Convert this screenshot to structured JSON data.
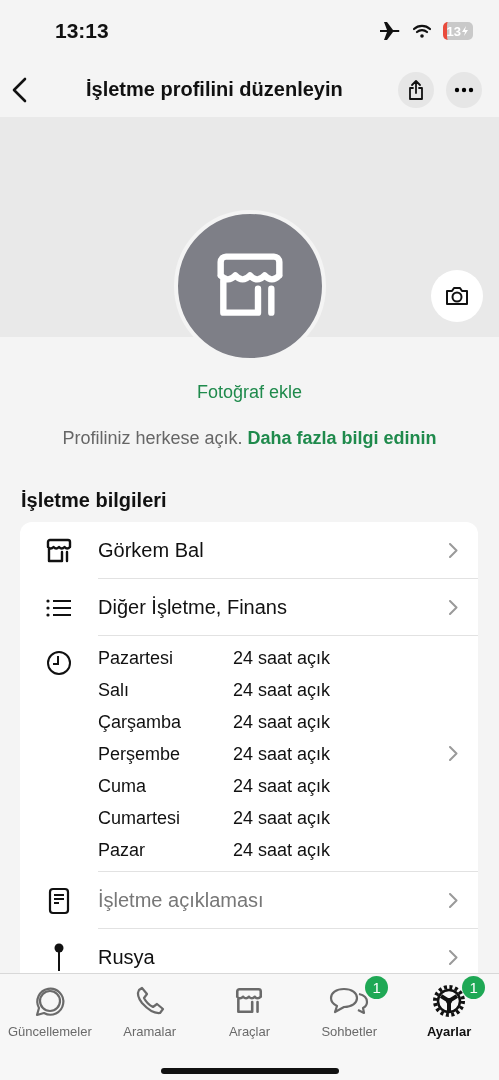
{
  "status_bar": {
    "time": "13:13",
    "battery": "13"
  },
  "nav": {
    "title": "İşletme profilini düzenleyin"
  },
  "profile": {
    "add_photo": "Fotoğraf ekle",
    "notice": "Profiliniz herkese açık.",
    "notice_link": "Daha fazla bilgi edinin"
  },
  "section_title": "İşletme bilgileri",
  "rows": [
    {
      "kind": "text",
      "label": "Görkem Bal",
      "muted": false
    },
    {
      "kind": "text",
      "label": "Diğer İşletme, Finans",
      "muted": false
    },
    {
      "kind": "hours",
      "hours": [
        {
          "day": "Pazartesi",
          "time": "24 saat açık"
        },
        {
          "day": "Salı",
          "time": "24 saat açık"
        },
        {
          "day": "Çarşamba",
          "time": "24 saat açık"
        },
        {
          "day": "Perşembe",
          "time": "24 saat açık"
        },
        {
          "day": "Cuma",
          "time": "24 saat açık"
        },
        {
          "day": "Cumartesi",
          "time": "24 saat açık"
        },
        {
          "day": "Pazar",
          "time": "24 saat açık"
        }
      ]
    },
    {
      "kind": "text",
      "label": "İşletme açıklaması",
      "muted": true
    },
    {
      "kind": "text",
      "label": "Rusya",
      "muted": false
    }
  ],
  "tabs": [
    {
      "label": "Güncellemeler",
      "selected": false
    },
    {
      "label": "Aramalar",
      "selected": false
    },
    {
      "label": "Araçlar",
      "selected": false
    },
    {
      "label": "Sohbetler",
      "selected": false,
      "badge": "1"
    },
    {
      "label": "Ayarlar",
      "selected": true,
      "badge": "1"
    }
  ]
}
